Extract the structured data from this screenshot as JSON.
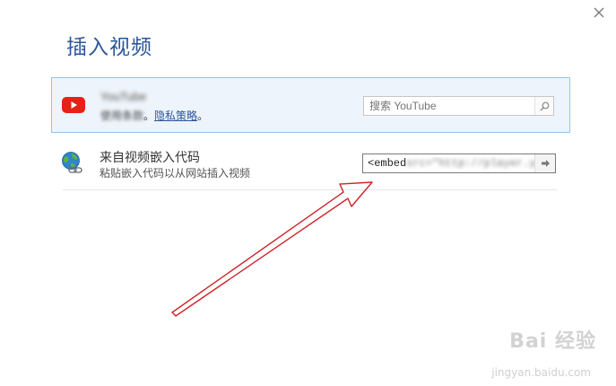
{
  "dialog": {
    "title": "插入视频",
    "close_icon": "close-icon"
  },
  "youtube": {
    "name": "YouTube",
    "terms_prefix": "使用条款",
    "terms_separator": "。",
    "privacy_link": "隐私策略",
    "terms_suffix": "。",
    "search_placeholder": "搜索 YouTube",
    "brand_color": "#e62117"
  },
  "embed": {
    "title": "来自视频嵌入代码",
    "description": "粘贴嵌入代码以从网站插入视频",
    "code_visible": "<embed",
    "code_blurred": "src=\"http://player.youk"
  },
  "watermark": {
    "brand": "Bai 经验",
    "url": "jingyan.baidu.com"
  },
  "colors": {
    "accent": "#2b579a",
    "selected_bg": "#eef4fb",
    "selected_border": "#9cc3e6",
    "annotation_arrow": "#d0222a"
  }
}
